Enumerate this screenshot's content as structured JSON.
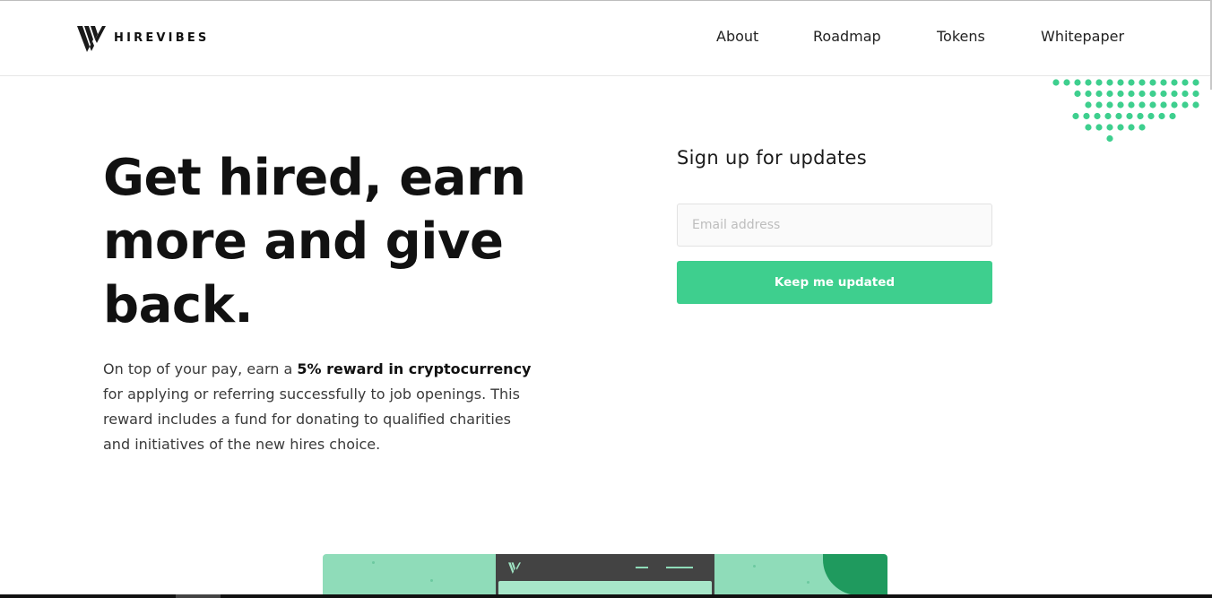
{
  "brand": {
    "name": "HIREVIBES",
    "accent_color": "#3ecf8e",
    "logo_icon": "hirevibes-logo-icon"
  },
  "nav": {
    "items": [
      {
        "label": "About"
      },
      {
        "label": "Roadmap"
      },
      {
        "label": "Tokens"
      },
      {
        "label": "Whitepaper"
      }
    ]
  },
  "hero": {
    "title": "Get hired, earn more and give back.",
    "copy_before": "On top of your pay, earn a ",
    "copy_bold": "5% reward in cryptocurrency",
    "copy_after": " for applying or referring successfully to job openings. This reward includes a fund for donating to qualified charities and initiatives of the new hires choice."
  },
  "signup": {
    "title": "Sign up for updates",
    "email_placeholder": "Email address",
    "email_value": "",
    "button_label": "Keep me updated"
  }
}
